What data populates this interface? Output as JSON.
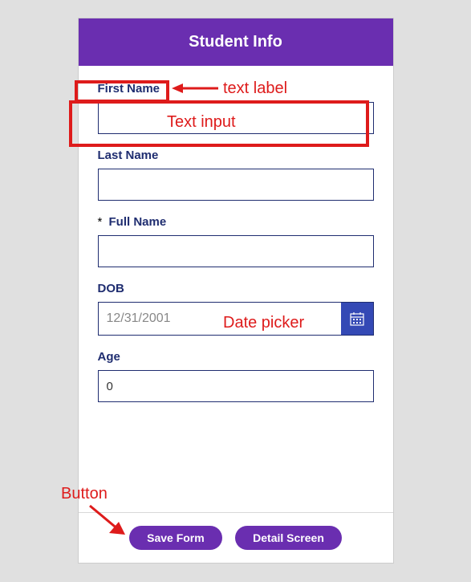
{
  "header": {
    "title": "Student Info"
  },
  "fields": {
    "firstName": {
      "label": "First Name",
      "value": ""
    },
    "lastName": {
      "label": "Last Name",
      "value": ""
    },
    "fullName": {
      "label": "Full Name",
      "value": "",
      "required": true
    },
    "dob": {
      "label": "DOB",
      "value": "12/31/2001"
    },
    "age": {
      "label": "Age",
      "value": "0"
    }
  },
  "buttons": {
    "save": "Save Form",
    "detail": "Detail Screen"
  },
  "annotations": {
    "textLabel": "text label",
    "textInput": "Text input",
    "datePicker": "Date picker",
    "button": "Button"
  }
}
